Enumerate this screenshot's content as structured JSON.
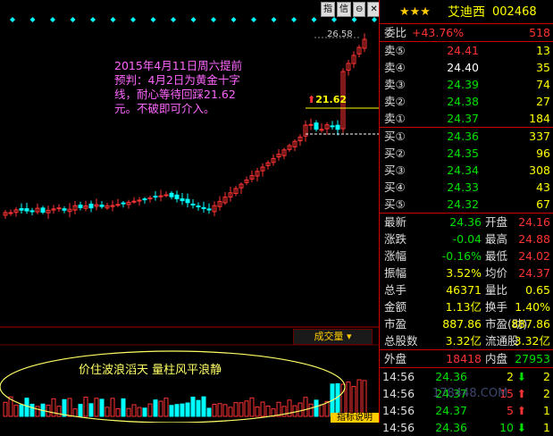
{
  "chart": {
    "max_label": "26.58",
    "target_label": "21.62",
    "annotation": "2015年4月11日周六提前\n预判：4月2日为黄金十字\n线，耐心等待回踩21.62\n元。不破即可介入。",
    "volume_tab": "成交量 ▾",
    "volume_note": "价住波浪滔天  量柱风平浪静",
    "indicator_button": "指标说明",
    "top_icons": [
      "指",
      "信息",
      "⊖",
      "✕"
    ],
    "watermark": "178448.COM",
    "colors": {
      "up": "#ff3333",
      "down": "#00ffff",
      "note": "#ff66ff",
      "diamond": "#00ffff"
    }
  },
  "quote": {
    "stars": "★★★",
    "name": "艾迪西",
    "code": "002468",
    "weibi": {
      "label": "委比",
      "pct": "+43.76%",
      "value": "518"
    },
    "asks": [
      {
        "label": "卖⑤",
        "price": "24.41",
        "vol": "13"
      },
      {
        "label": "卖④",
        "price": "24.40",
        "vol": "35"
      },
      {
        "label": "卖③",
        "price": "24.39",
        "vol": "74"
      },
      {
        "label": "卖②",
        "price": "24.38",
        "vol": "27"
      },
      {
        "label": "卖①",
        "price": "24.37",
        "vol": "184"
      }
    ],
    "bids": [
      {
        "label": "买①",
        "price": "24.36",
        "vol": "337"
      },
      {
        "label": "买②",
        "price": "24.35",
        "vol": "96"
      },
      {
        "label": "买③",
        "price": "24.34",
        "vol": "308"
      },
      {
        "label": "买④",
        "price": "24.33",
        "vol": "43"
      },
      {
        "label": "买⑤",
        "price": "24.32",
        "vol": "67"
      }
    ],
    "stats": [
      {
        "l1": "最新",
        "v1": "24.36",
        "l2": "开盘",
        "v2": "24.16"
      },
      {
        "l1": "涨跌",
        "v1": "-0.04",
        "l2": "最高",
        "v2": "24.88"
      },
      {
        "l1": "涨幅",
        "v1": "-0.16%",
        "l2": "最低",
        "v2": "24.02"
      },
      {
        "l1": "振幅",
        "v1": "3.52%",
        "l2": "均价",
        "v2": "24.37"
      },
      {
        "l1": "总手",
        "v1": "46371",
        "l2": "量比",
        "v2": "0.65"
      },
      {
        "l1": "金额",
        "v1": "1.13亿",
        "l2": "换手",
        "v2": "1.40%"
      },
      {
        "l1": "市盈",
        "v1": "887.86",
        "l2": "市盈(动)",
        "v2": "887.86"
      },
      {
        "l1": "总股数",
        "v1": "3.32亿",
        "l2": "流通股",
        "v2": "3.32亿"
      }
    ],
    "outer_label": "外盘",
    "outer_value": "18418",
    "inner_label": "内盘",
    "inner_value": "27953",
    "ticks": [
      {
        "time": "14:56",
        "price": "24.36",
        "vol": "2",
        "dir": "down",
        "n": "2"
      },
      {
        "time": "14:56",
        "price": "24.37",
        "vol": "15",
        "dir": "up",
        "n": "2"
      },
      {
        "time": "14:56",
        "price": "24.37",
        "vol": "5",
        "dir": "up",
        "n": "1"
      },
      {
        "time": "14:56",
        "price": "24.36",
        "vol": "10",
        "dir": "down",
        "n": "1"
      }
    ]
  }
}
